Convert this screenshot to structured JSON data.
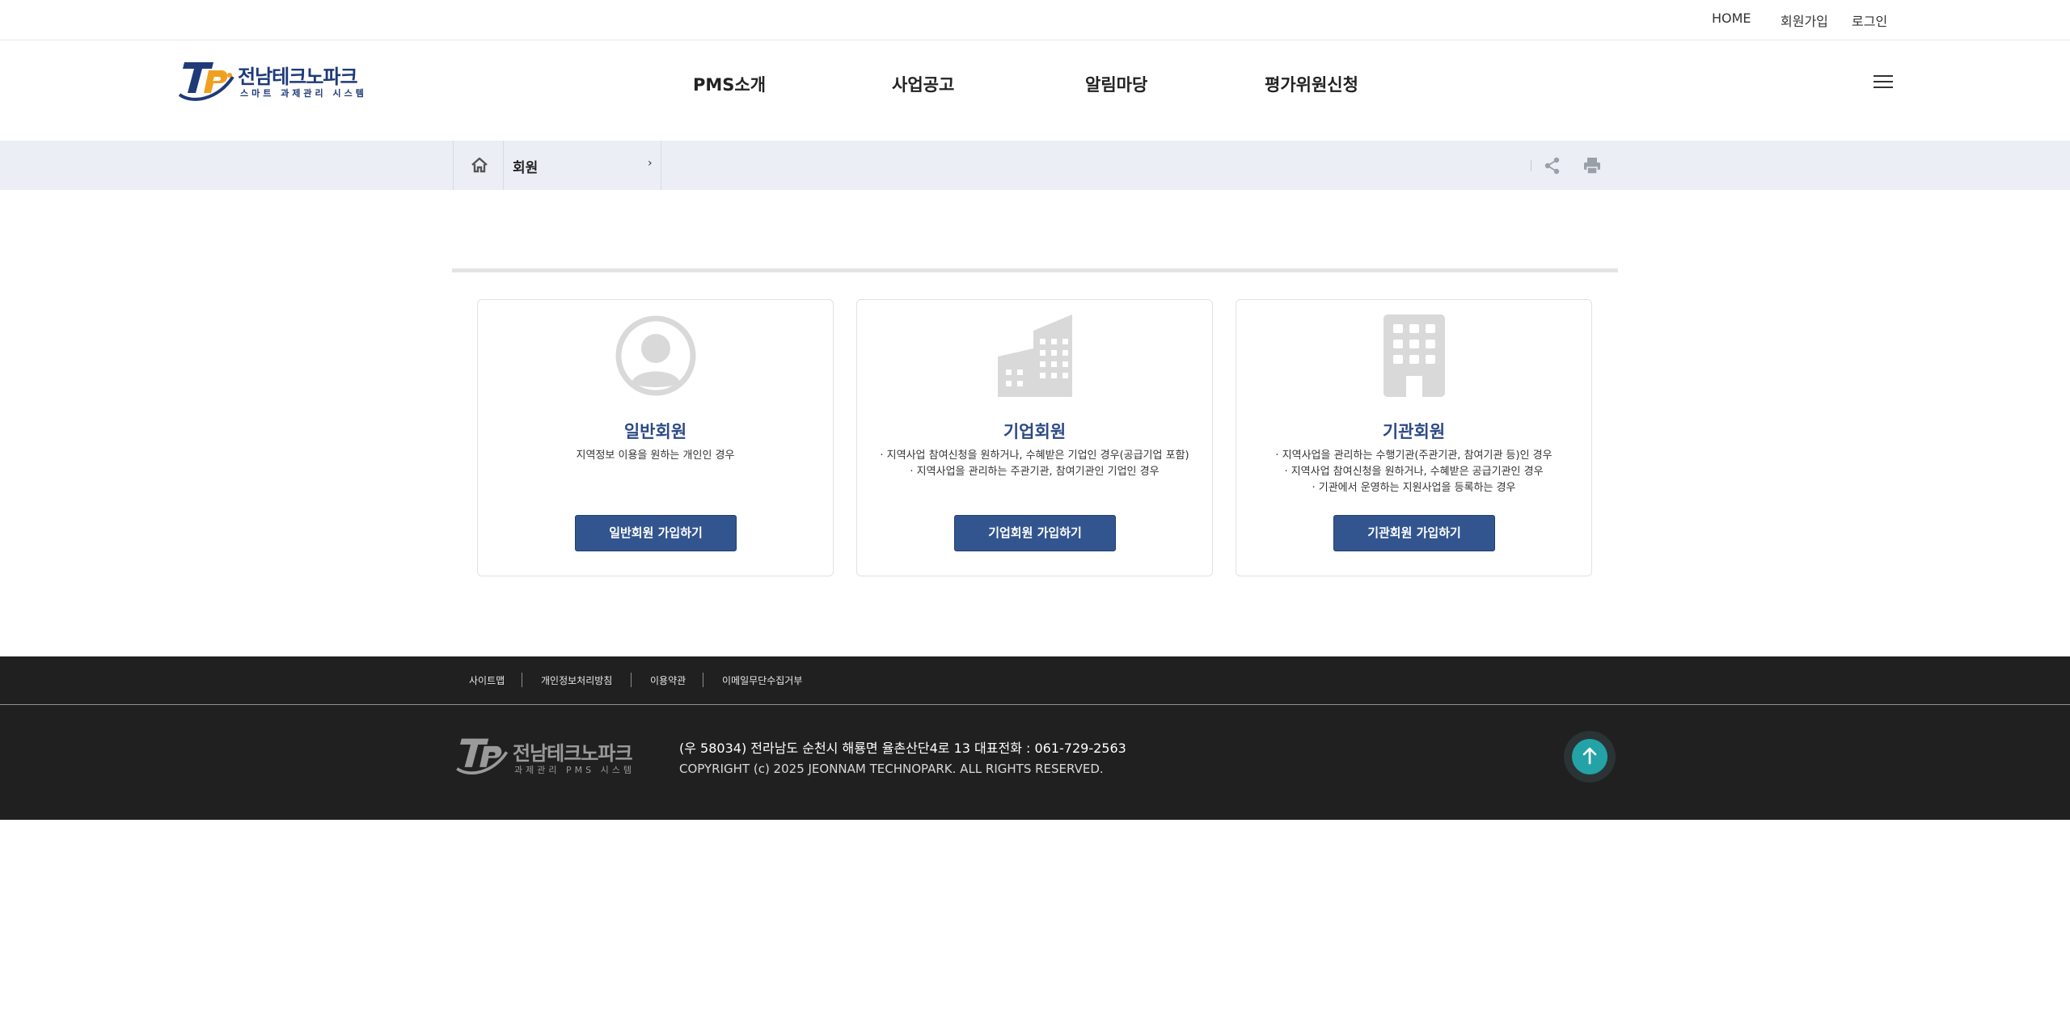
{
  "utility_nav": {
    "home": "HOME",
    "join": "회원가입",
    "login": "로그인"
  },
  "logo": {
    "name": "전남테크노파크",
    "subtitle": "스마트 과제관리 시스템",
    "mark_text": "TP"
  },
  "gnb": {
    "items": [
      "PMS소개",
      "사업공고",
      "알림마당",
      "평가위원신청"
    ]
  },
  "breadcrumb": {
    "current": "회원",
    "chevron": "›"
  },
  "icons": {
    "home": "home-icon",
    "share": "share-icon",
    "print": "print-icon",
    "menu": "hamburger-menu-icon",
    "top": "arrow-up-icon"
  },
  "cards": [
    {
      "title": "일반회원",
      "descriptions": [
        "지역정보 이용을 원하는 개인인 경우"
      ],
      "button": "일반회원 가입하기",
      "icon": "person-icon"
    },
    {
      "title": "기업회원",
      "descriptions": [
        "· 지역사업 참여신청을 원하거나, 수혜받은 기업인 경우(공급기업 포함)",
        "· 지역사업을 관리하는 주관기관, 참여기관인 기업인 경우"
      ],
      "button": "기업회원 가입하기",
      "icon": "company-building-icon"
    },
    {
      "title": "기관회원",
      "descriptions": [
        "· 지역사업을 관리하는 수행기관(주관기관, 참여기관 등)인 경우",
        "· 지역사업 참여신청을 원하거나, 수혜받은 공급기관인 경우",
        "· 기관에서 운영하는 지원사업을 등록하는 경우"
      ],
      "button": "기관회원 가입하기",
      "icon": "institution-building-icon"
    }
  ],
  "footer": {
    "links": [
      "사이트맵",
      "개인정보처리방침",
      "이용약관",
      "이메일무단수집거부"
    ],
    "logo_name": "전남테크노파크",
    "logo_subtitle": "과제관리 PMS 시스템",
    "logo_mark": "TP",
    "address": "(우 58034) 전라남도 순천시 해룡면 율촌산단4로 13    대표전화 : 061-729-2563",
    "copyright": "COPYRIGHT (c) 2025 JEONNAM TECHNOPARK. ALL RIGHTS RESERVED."
  },
  "colors": {
    "brand_navy": "#1e3a78",
    "brand_orange": "#f0a020",
    "button_blue": "#33558f",
    "breadcrumb_bg": "#ebeff5",
    "footer_bg": "#202020",
    "top_button": "#23a3a6",
    "icon_gray": "#d9d9d9"
  }
}
